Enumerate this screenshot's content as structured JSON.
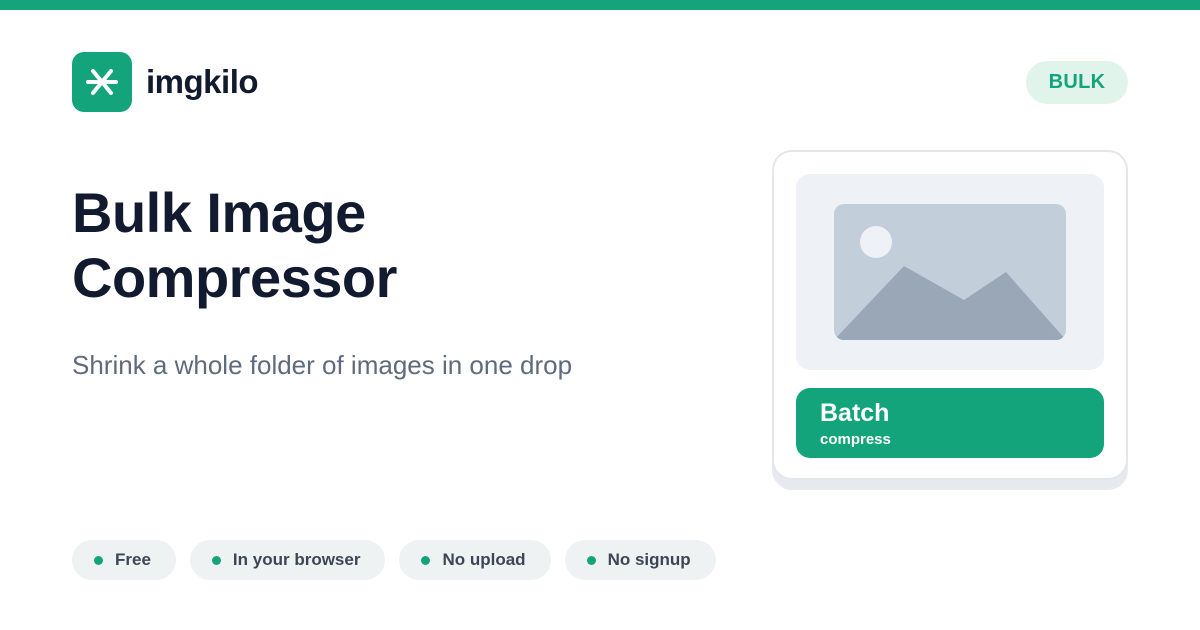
{
  "brand": {
    "name": "imgkilo",
    "logo_icon": "asterisk-icon",
    "accent": "#13a47b"
  },
  "badge": {
    "label": "BULK"
  },
  "hero": {
    "title": "Bulk Image Compressor",
    "subtitle": "Shrink a whole folder of images in one drop"
  },
  "card": {
    "preview_icon": "image-placeholder-icon",
    "action": {
      "title": "Batch",
      "subtitle": "compress"
    }
  },
  "features": [
    {
      "label": "Free"
    },
    {
      "label": "In your browser"
    },
    {
      "label": "No upload"
    },
    {
      "label": "No signup"
    }
  ]
}
